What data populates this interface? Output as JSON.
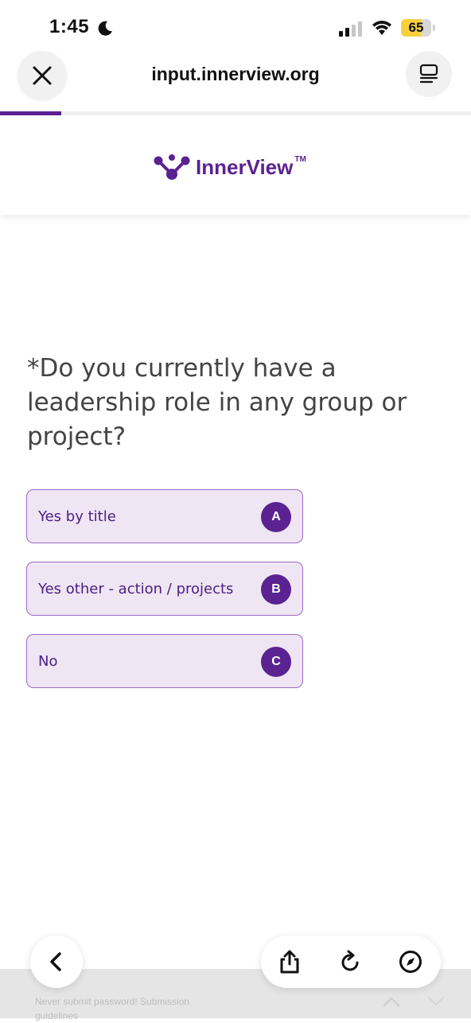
{
  "status_bar": {
    "time": "1:45",
    "battery": "65",
    "battery_fraction": 0.65,
    "icons": [
      "moon-icon",
      "signal-icon",
      "wifi-icon",
      "battery-icon"
    ]
  },
  "browser": {
    "url": "input.innerview.org",
    "close_icon": "close-icon",
    "tabs_icon": "tabs-icon",
    "progress_fraction": 0.13
  },
  "logo": {
    "name": "InnerView",
    "trademark": "TM"
  },
  "question": {
    "text": "*Do you currently have a leadership role in any group or project?"
  },
  "options": [
    {
      "label": "Yes by title",
      "key": "A"
    },
    {
      "label": "Yes other - action / projects",
      "key": "B"
    },
    {
      "label": "No",
      "key": "C"
    }
  ],
  "footer": {
    "notice": "Never submit password! Submission guidelines"
  },
  "toolbar": {
    "icons": [
      "back-icon",
      "share-icon",
      "reload-icon",
      "compass-icon"
    ]
  },
  "colors": {
    "brand": "#5b2291",
    "option_bg": "#efe5f3",
    "option_border": "#9a6bc4"
  }
}
